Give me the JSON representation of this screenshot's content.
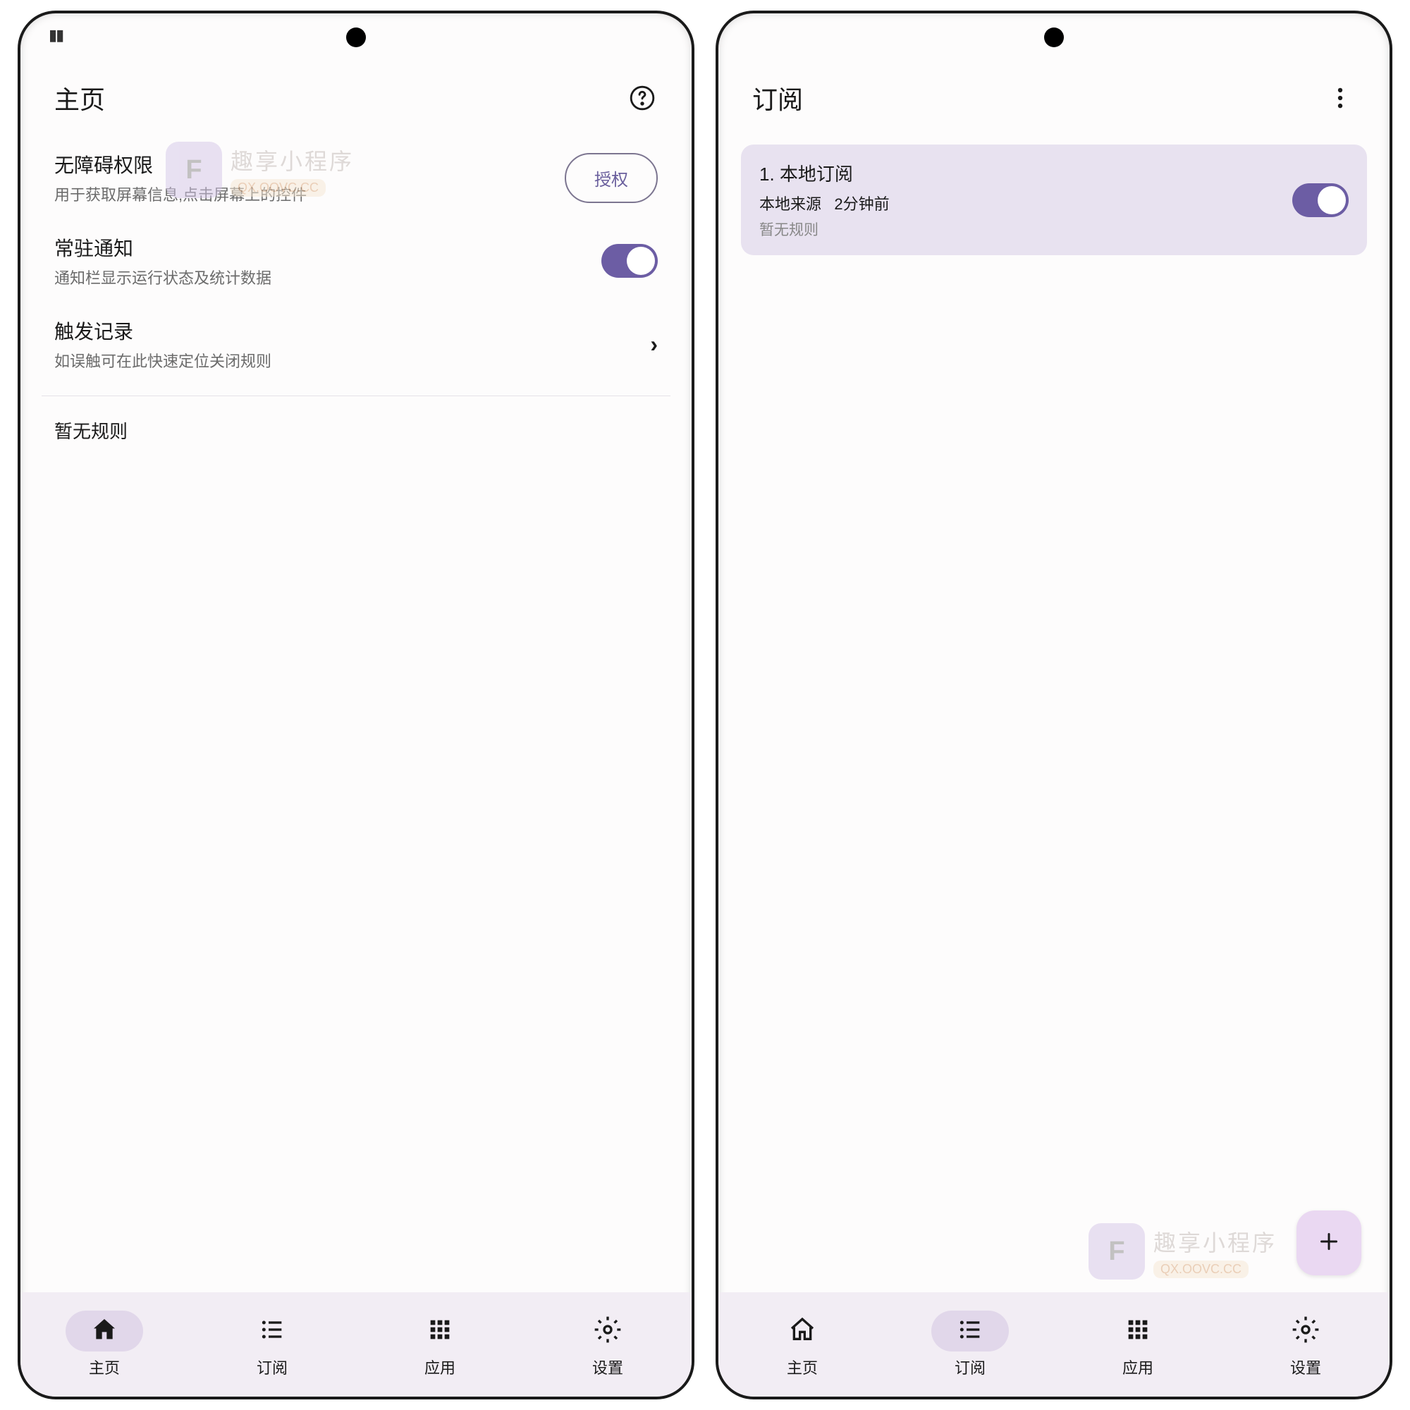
{
  "left": {
    "title": "主页",
    "accessibility": {
      "title": "无障碍权限",
      "sub": "用于获取屏幕信息,点击屏幕上的控件",
      "button": "授权"
    },
    "notification": {
      "title": "常驻通知",
      "sub": "通知栏显示运行状态及统计数据"
    },
    "trigger": {
      "title": "触发记录",
      "sub": "如误触可在此快速定位关闭规则"
    },
    "empty": "暂无规则"
  },
  "right": {
    "title": "订阅",
    "card": {
      "title": "1. 本地订阅",
      "sourcePrefix": "本地来源",
      "time": "2分钟前",
      "empty": "暂无规则"
    }
  },
  "nav": {
    "home": "主页",
    "subscribe": "订阅",
    "apps": "应用",
    "settings": "设置"
  },
  "watermark": {
    "title": "趣享小程序",
    "url": "QX.OOVC.CC"
  }
}
